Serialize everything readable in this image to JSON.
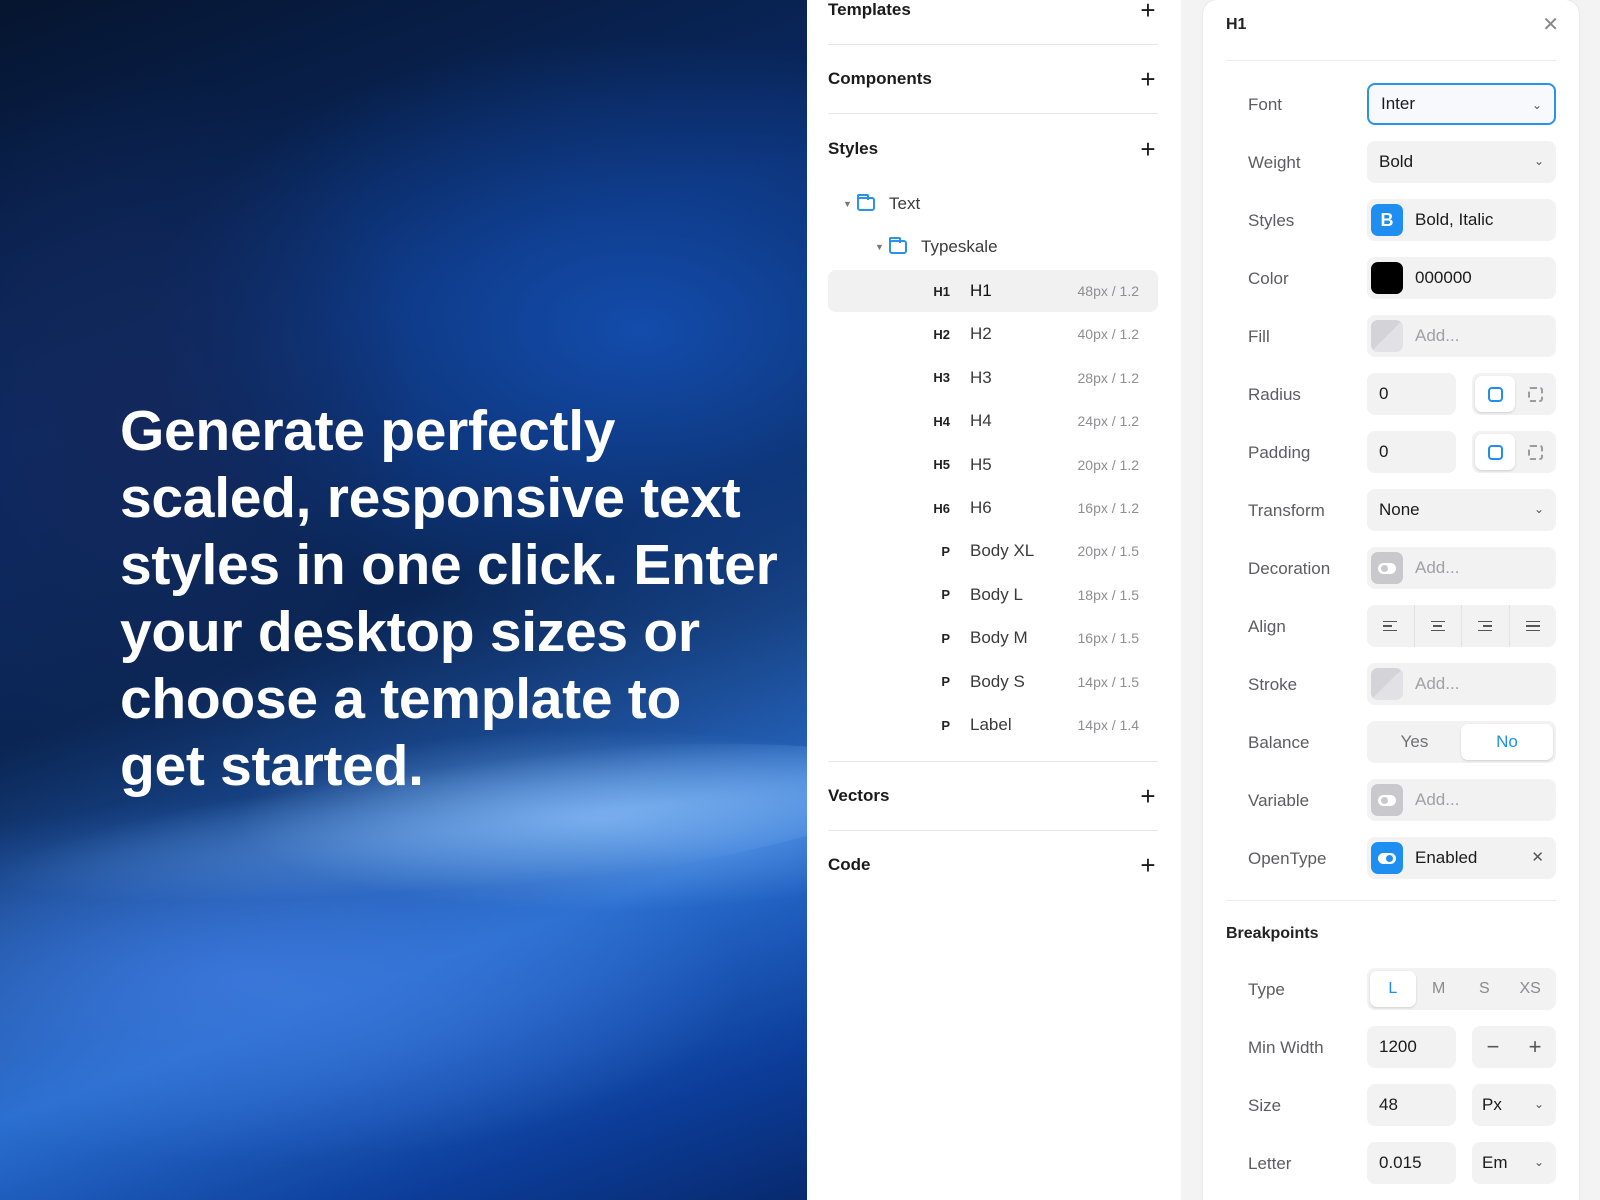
{
  "hero": {
    "text": "Generate perfectly scaled, responsive text styles in one click. Enter your desktop sizes or choose a template to get started."
  },
  "sidebar": {
    "sections": {
      "templates": "Templates",
      "components": "Components",
      "styles": "Styles",
      "vectors": "Vectors",
      "code": "Code"
    },
    "tree": {
      "folder1": "Text",
      "folder2": "Typeskale"
    },
    "styles": [
      {
        "tag": "H1",
        "name": "H1",
        "meta": "48px / 1.2"
      },
      {
        "tag": "H2",
        "name": "H2",
        "meta": "40px / 1.2"
      },
      {
        "tag": "H3",
        "name": "H3",
        "meta": "28px / 1.2"
      },
      {
        "tag": "H4",
        "name": "H4",
        "meta": "24px / 1.2"
      },
      {
        "tag": "H5",
        "name": "H5",
        "meta": "20px / 1.2"
      },
      {
        "tag": "H6",
        "name": "H6",
        "meta": "16px / 1.2"
      },
      {
        "tag": "P",
        "name": "Body XL",
        "meta": "20px / 1.5"
      },
      {
        "tag": "P",
        "name": "Body L",
        "meta": "18px / 1.5"
      },
      {
        "tag": "P",
        "name": "Body M",
        "meta": "16px / 1.5"
      },
      {
        "tag": "P",
        "name": "Body S",
        "meta": "14px / 1.5"
      },
      {
        "tag": "P",
        "name": "Label",
        "meta": "14px / 1.4"
      }
    ]
  },
  "inspector": {
    "title": "H1",
    "props": {
      "font": {
        "label": "Font",
        "value": "Inter"
      },
      "weight": {
        "label": "Weight",
        "value": "Bold"
      },
      "styles": {
        "label": "Styles",
        "value": "Bold, Italic",
        "icon_letter": "B"
      },
      "color": {
        "label": "Color",
        "value": "000000",
        "swatch": "#000000"
      },
      "fill": {
        "label": "Fill",
        "placeholder": "Add..."
      },
      "radius": {
        "label": "Radius",
        "value": "0"
      },
      "padding": {
        "label": "Padding",
        "value": "0"
      },
      "transform": {
        "label": "Transform",
        "value": "None"
      },
      "decoration": {
        "label": "Decoration",
        "placeholder": "Add..."
      },
      "align": {
        "label": "Align"
      },
      "stroke": {
        "label": "Stroke",
        "placeholder": "Add..."
      },
      "balance": {
        "label": "Balance",
        "yes": "Yes",
        "no": "No"
      },
      "variable": {
        "label": "Variable",
        "placeholder": "Add..."
      },
      "opentype": {
        "label": "OpenType",
        "value": "Enabled"
      }
    },
    "breakpoints": {
      "title": "Breakpoints",
      "type": {
        "label": "Type",
        "options": [
          "L",
          "M",
          "S",
          "XS"
        ]
      },
      "min_width": {
        "label": "Min Width",
        "value": "1200"
      },
      "size": {
        "label": "Size",
        "value": "48",
        "unit": "Px"
      },
      "letter": {
        "label": "Letter",
        "value": "0.015",
        "unit": "Em"
      }
    }
  },
  "colors": {
    "accent": "#1e8ff0"
  }
}
